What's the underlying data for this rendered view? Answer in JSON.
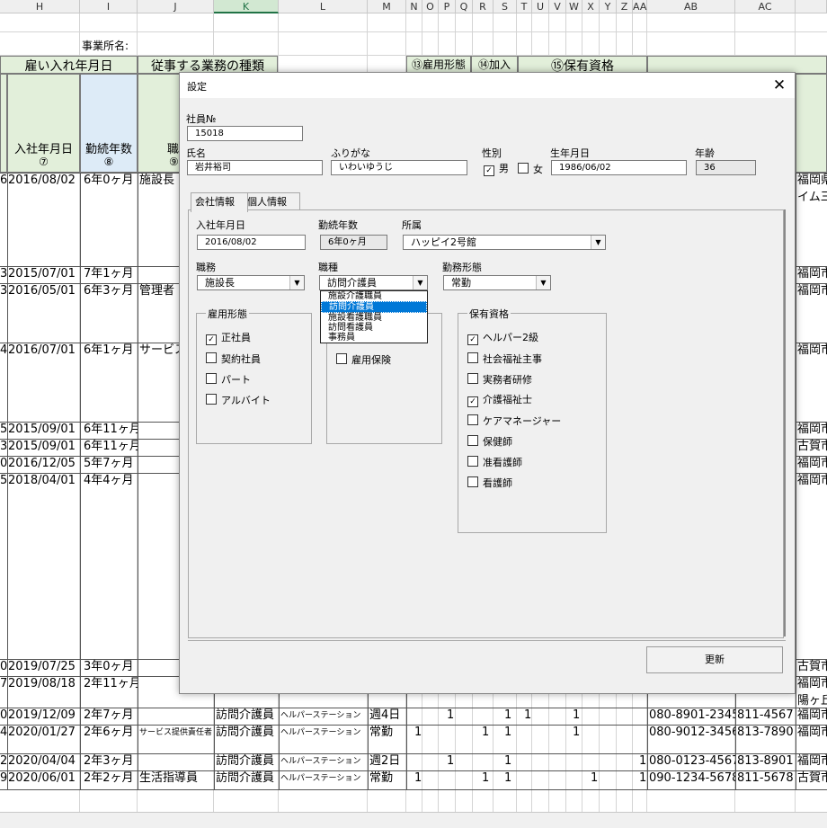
{
  "sheet": {
    "columns": [
      "H",
      "I",
      "J",
      "K",
      "L",
      "M",
      "N",
      "O",
      "P",
      "Q",
      "R",
      "S",
      "T",
      "U",
      "V",
      "W",
      "X",
      "Y",
      "Z",
      "AA",
      "AB",
      "AC"
    ],
    "office_label": "事業所名:",
    "band_hire": "雇い入れ年月日",
    "band_work": "従事する業務の種類",
    "band_emp": "⑬雇用形態",
    "band_ins": "⑭加入",
    "band_qual": "⑮保有資格",
    "hdr_hire_date": "入社年月日",
    "hdr_hire_num": "⑦",
    "hdr_tenure": "勤続年数",
    "hdr_tenure_num": "⑧",
    "hdr_job": "職",
    "hdr_job_num": "⑨",
    "rows": [
      {
        "idx": "6",
        "date": "2016/08/02",
        "tenure": "6年0ヶ月",
        "job": "施設長",
        "k": "",
        "l": "",
        "m": "",
        "phone": "",
        "fax": "",
        "addr": "福岡県",
        "addr2": "イム三"
      },
      {
        "idx": "3",
        "date": "2015/07/01",
        "tenure": "7年1ヶ月",
        "job": "",
        "k": "",
        "l": "",
        "m": "",
        "phone": "",
        "fax": "",
        "addr": "福岡市",
        "addr2": ""
      },
      {
        "idx": "3",
        "date": "2016/05/01",
        "tenure": "6年3ヶ月",
        "job": "管理者",
        "k": "",
        "l": "",
        "m": "",
        "phone": "",
        "fax": "",
        "addr": "福岡市",
        "addr2": ""
      },
      {
        "idx": "4",
        "date": "2016/07/01",
        "tenure": "6年1ヶ月",
        "job": "サービス提供",
        "k": "",
        "l": "",
        "m": "",
        "phone": "",
        "fax": "",
        "addr": "福岡市",
        "addr2": ""
      },
      {
        "idx": "5",
        "date": "2015/09/01",
        "tenure": "6年11ヶ月",
        "job": "",
        "k": "",
        "l": "",
        "m": "",
        "phone": "",
        "fax": "",
        "addr": "福岡市",
        "addr2": ""
      },
      {
        "idx": "3",
        "date": "2015/09/01",
        "tenure": "6年11ヶ月",
        "job": "",
        "k": "",
        "l": "",
        "m": "",
        "phone": "",
        "fax": "",
        "addr": "古賀市",
        "addr2": ""
      },
      {
        "idx": "0",
        "date": "2016/12/05",
        "tenure": "5年7ヶ月",
        "job": "",
        "k": "",
        "l": "",
        "m": "",
        "phone": "",
        "fax": "",
        "addr": "福岡市",
        "addr2": ""
      },
      {
        "idx": "5",
        "date": "2018/04/01",
        "tenure": "4年4ヶ月",
        "job": "",
        "k": "",
        "l": "",
        "m": "",
        "phone": "",
        "fax": "",
        "addr": "福岡市",
        "addr2": ""
      },
      {
        "idx": "0",
        "date": "2019/07/25",
        "tenure": "3年0ヶ月",
        "job": "",
        "k": "",
        "l": "",
        "m": "",
        "phone": "",
        "fax": "",
        "addr": "古賀市",
        "addr2": ""
      },
      {
        "idx": "7",
        "date": "2019/08/18",
        "tenure": "2年11ヶ月",
        "job": "",
        "k": "",
        "l": "",
        "m": "",
        "phone": "",
        "fax": "",
        "addr": "福岡市",
        "addr2": "陽ヶ丘"
      },
      {
        "idx": "0",
        "date": "2019/12/09",
        "tenure": "2年7ヶ月",
        "job": "",
        "k": "訪問介護員",
        "l": "ヘルパーステーション",
        "m": "週4日",
        "phone": "080-8901-2345",
        "fax": "811-4567",
        "addr": "福岡市",
        "addr2": ""
      },
      {
        "idx": "4",
        "date": "2020/01/27",
        "tenure": "2年6ヶ月",
        "job": "サービス提供責任者",
        "k": "訪問介護員",
        "l": "ヘルパーステーション",
        "m": "常勤",
        "phone": "080-9012-3456",
        "fax": "813-7890",
        "addr": "福岡市",
        "addr2": ""
      },
      {
        "idx": "2",
        "date": "2020/04/04",
        "tenure": "2年3ヶ月",
        "job": "",
        "k": "訪問介護員",
        "l": "ヘルパーステーション",
        "m": "週2日",
        "phone": "080-0123-4567",
        "fax": "813-8901",
        "addr": "福岡市",
        "addr2": ""
      },
      {
        "idx": "9",
        "date": "2020/06/01",
        "tenure": "2年2ヶ月",
        "job": "生活指導員",
        "k": "訪問介護員",
        "l": "ヘルパーステーション",
        "m": "常勤",
        "phone": "090-1234-5678",
        "fax": "811-5678",
        "addr": "古賀市",
        "addr2": ""
      }
    ],
    "ones": "1"
  },
  "dialog": {
    "title": "設定",
    "close": "✕",
    "emp_no_label": "社員№",
    "emp_no": "15018",
    "name_label": "氏名",
    "name": "岩井裕司",
    "kana_label": "ふりがな",
    "kana": "いわいゆうじ",
    "gender_label": "性別",
    "gender_male": "男",
    "gender_female": "女",
    "birth_label": "生年月日",
    "birth": "1986/06/02",
    "age_label": "年齢",
    "age": "36",
    "tab_company": "会社情報",
    "tab_personal": "個人情報",
    "join_label": "入社年月日",
    "join_date": "2016/08/02",
    "tenure_label": "勤続年数",
    "tenure": "6年0ヶ月",
    "dept_label": "所属",
    "dept": "ハッピイ2号館",
    "role_label": "職務",
    "role": "施設長",
    "jobtype_label": "職種",
    "jobtype": "訪問介護員",
    "worktype_label": "勤務形態",
    "worktype": "常勤",
    "jobtype_options": [
      "施設介護職員",
      "訪問介護員",
      "施設看護職員",
      "訪問看護員",
      "事務員"
    ],
    "emp_group_title": "雇用形態",
    "emp_options": [
      {
        "label": "正社員",
        "checked": true
      },
      {
        "label": "契約社員",
        "checked": false
      },
      {
        "label": "パート",
        "checked": false
      },
      {
        "label": "アルバイト",
        "checked": false
      }
    ],
    "insurance_label": "雇用保険",
    "qual_group_title": "保有資格",
    "qual_options": [
      {
        "label": "ヘルパー2級",
        "checked": true
      },
      {
        "label": "社会福祉主事",
        "checked": false
      },
      {
        "label": "実務者研修",
        "checked": false
      },
      {
        "label": "介護福祉士",
        "checked": true
      },
      {
        "label": "ケアマネージャー",
        "checked": false
      },
      {
        "label": "保健師",
        "checked": false
      },
      {
        "label": "准看護師",
        "checked": false
      },
      {
        "label": "看護師",
        "checked": false
      }
    ],
    "update_label": "更新",
    "check_mark": "✓"
  }
}
